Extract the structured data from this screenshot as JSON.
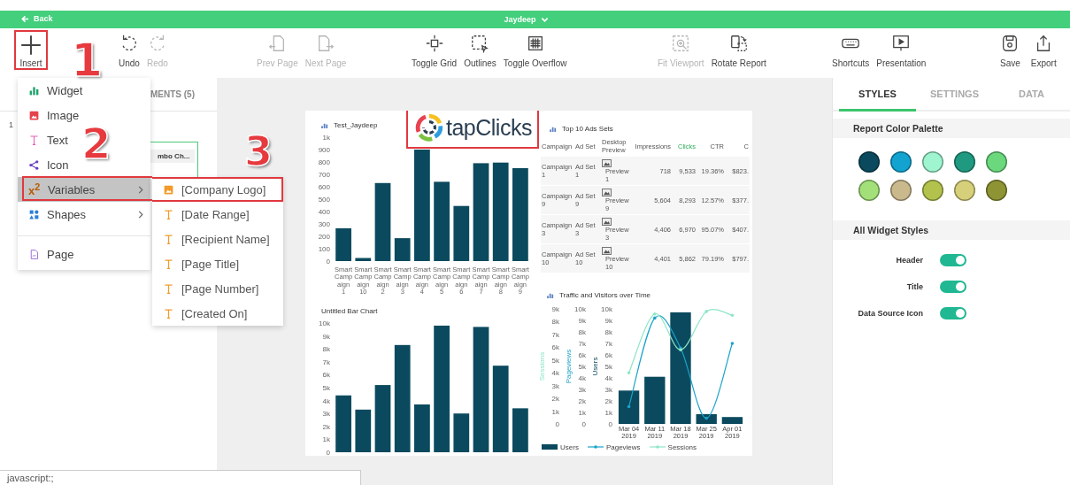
{
  "top_bar": {
    "back": "Back",
    "user": "Jaydeep"
  },
  "toolbar": {
    "groups": [
      [
        {
          "label": "Insert",
          "disabled": false,
          "highlighted": true
        }
      ],
      [
        {
          "label": "Undo",
          "disabled": false,
          "highlighted": false
        },
        {
          "label": "Redo",
          "disabled": true,
          "highlighted": false
        }
      ],
      [
        {
          "label": "Prev Page",
          "disabled": true,
          "highlighted": false
        },
        {
          "label": "Next Page",
          "disabled": true,
          "highlighted": false
        }
      ],
      [
        {
          "label": "Toggle Grid",
          "disabled": false,
          "highlighted": false
        },
        {
          "label": "Outlines",
          "disabled": false,
          "highlighted": false
        },
        {
          "label": "Toggle Overflow",
          "disabled": false,
          "highlighted": false
        }
      ],
      [
        {
          "label": "Fit Viewport",
          "disabled": true,
          "highlighted": false
        },
        {
          "label": "Rotate Report",
          "disabled": false,
          "highlighted": false
        }
      ],
      [
        {
          "label": "Shortcuts",
          "disabled": false,
          "highlighted": false
        },
        {
          "label": "Presentation",
          "disabled": false,
          "highlighted": false
        }
      ],
      [
        {
          "label": "Save",
          "disabled": false,
          "highlighted": false
        },
        {
          "label": "Export",
          "disabled": false,
          "highlighted": false
        }
      ]
    ]
  },
  "left_panel": {
    "tab": "MENTS (5)",
    "page_number": "1",
    "element": "mbo Ch..."
  },
  "insert_menu": {
    "items": [
      {
        "label": "Widget",
        "submenu": false,
        "hovered": false,
        "separator_before": false
      },
      {
        "label": "Image",
        "submenu": false,
        "hovered": false,
        "separator_before": false
      },
      {
        "label": "Text",
        "submenu": false,
        "hovered": false,
        "separator_before": false
      },
      {
        "label": "Icon",
        "submenu": false,
        "hovered": false,
        "separator_before": false
      },
      {
        "label": "Variables",
        "glyph": "x$^{2}$",
        "submenu": true,
        "hovered": true,
        "separator_before": false
      },
      {
        "label": "Shapes",
        "submenu": true,
        "hovered": false,
        "separator_before": false
      },
      {
        "label": "Page",
        "submenu": false,
        "hovered": false,
        "separator_before": true
      }
    ],
    "submenu": [
      {
        "label": "[Company Logo]",
        "kind": "image",
        "highlighted": true
      },
      {
        "label": "[Date Range]",
        "kind": "text",
        "highlighted": false
      },
      {
        "label": "[Recipient Name]",
        "kind": "text",
        "highlighted": false
      },
      {
        "label": "[Page Title]",
        "kind": "text",
        "highlighted": false
      },
      {
        "label": "[Page Number]",
        "kind": "text",
        "highlighted": false
      },
      {
        "label": "[Created On]",
        "kind": "text",
        "highlighted": false
      }
    ]
  },
  "callouts": [
    {
      "number": "1"
    },
    {
      "number": "2"
    },
    {
      "number": "3"
    }
  ],
  "report": {
    "bar_chart": {
      "title": "Test_Jaydeep",
      "chart_data": {
        "type": "bar",
        "categories": [
          "Smart Campaign 1",
          "Smart Campaign 10",
          "Smart Campaign 2",
          "Smart Campaign 3",
          "Smart Campaign 4",
          "Smart Campaign 5",
          "Smart Campaign 6",
          "Smart Campaign 7",
          "Smart Campaign 8",
          "Smart Campaign 9"
        ],
        "values": [
          265,
          25,
          630,
          185,
          900,
          640,
          445,
          790,
          795,
          750
        ],
        "ylim": [
          0,
          1000
        ],
        "yticks": [
          0,
          100,
          200,
          300,
          400,
          500,
          600,
          700,
          800,
          900,
          {
            "value": 1000,
            "label": "1k"
          }
        ]
      }
    },
    "logo": {
      "text": "tapClicks",
      "highlighted": true
    },
    "table": {
      "title": "Top 10 Ads Sets",
      "columns": [
        {
          "label": "Campaign",
          "sorted": false
        },
        {
          "label": "Ad Set",
          "sorted": false
        },
        {
          "label": "Desktop Preview",
          "sorted": false
        },
        {
          "label": "Impressions",
          "sorted": false
        },
        {
          "label": "Clicks",
          "sorted": true
        },
        {
          "label": "CTR",
          "sorted": false
        },
        {
          "label": "C",
          "sorted": false
        }
      ],
      "rows": [
        [
          "Campaign 1",
          "Ad Set 1",
          "Preview 1",
          "718",
          "9,533",
          "19.36%",
          "$823."
        ],
        [
          "Campaign 9",
          "Ad Set 9",
          "Preview 9",
          "5,604",
          "8,293",
          "12.57%",
          "$377."
        ],
        [
          "Campaign 3",
          "Ad Set 3",
          "Preview 3",
          "4,406",
          "6,970",
          "95.07%",
          "$407."
        ],
        [
          "Campaign 10",
          "Ad Set 10",
          "Preview 10",
          "4,401",
          "5,862",
          "79.19%",
          "$797."
        ]
      ]
    },
    "bar_chart_2": {
      "title": "Untitled Bar Chart",
      "chart_data": {
        "type": "bar",
        "values": [
          4400,
          3300,
          5200,
          8300,
          3700,
          9800,
          3000,
          9700,
          6700,
          3400
        ],
        "ylim": [
          0,
          10000
        ],
        "yticks": [
          0,
          {
            "value": 1000,
            "label": "1k"
          },
          {
            "value": 2000,
            "label": "2k"
          },
          {
            "value": 3000,
            "label": "3k"
          },
          {
            "value": 4000,
            "label": "4k"
          },
          {
            "value": 5000,
            "label": "5k"
          },
          {
            "value": 6000,
            "label": "6k"
          },
          {
            "value": 7000,
            "label": "7k"
          },
          {
            "value": 8000,
            "label": "8k"
          },
          {
            "value": 9000,
            "label": "9k"
          },
          {
            "value": 10000,
            "label": "10k"
          }
        ]
      }
    },
    "combo_chart": {
      "title": "Traffic and Visitors over Time",
      "chart_data": {
        "type": "bar",
        "categories": [
          "Mar 04 2019",
          "Mar 11 2019",
          "Mar 18 2019",
          "Mar 25 2019",
          "Apr 01 2019"
        ],
        "ylabel": "Pageviews",
        "ylim": [
          0,
          10000
        ],
        "yticks": [
          0,
          {
            "value": 1000,
            "label": "1k"
          },
          {
            "value": 2000,
            "label": "2k"
          },
          {
            "value": 3000,
            "label": "3k"
          },
          {
            "value": 4000,
            "label": "4k"
          },
          {
            "value": 5000,
            "label": "5k"
          },
          {
            "value": 6000,
            "label": "6k"
          },
          {
            "value": 7000,
            "label": "7k"
          },
          {
            "value": 8000,
            "label": "8k"
          },
          {
            "value": 9000,
            "label": "9k"
          },
          {
            "value": 10000,
            "label": "10k"
          }
        ],
        "y2label": "Users",
        "y2lim": [
          0,
          10000
        ],
        "y2ticks": [
          0,
          {
            "value": 1000,
            "label": "1k"
          },
          {
            "value": 2000,
            "label": "2k"
          },
          {
            "value": 3000,
            "label": "3k"
          },
          {
            "value": 4000,
            "label": "4k"
          },
          {
            "value": 5000,
            "label": "5k"
          },
          {
            "value": 6000,
            "label": "6k"
          },
          {
            "value": 7000,
            "label": "7k"
          },
          {
            "value": 8000,
            "label": "8k"
          },
          {
            "value": 9000,
            "label": "9k"
          },
          {
            "value": 10000,
            "label": "10k"
          }
        ],
        "y3label": "Sessions",
        "y3lim": [
          0,
          9000
        ],
        "y3ticks": [
          0,
          {
            "value": 1000,
            "label": "1k"
          },
          {
            "value": 2000,
            "label": "2k"
          },
          {
            "value": 3000,
            "label": "3k"
          },
          {
            "value": 4000,
            "label": "4k"
          },
          {
            "value": 5000,
            "label": "5k"
          },
          {
            "value": 6000,
            "label": "6k"
          },
          {
            "value": 7000,
            "label": "7k"
          },
          {
            "value": 8000,
            "label": "8k"
          },
          {
            "value": 9000,
            "label": "9k"
          }
        ],
        "legend": "bottom",
        "series": [
          {
            "name": "Users",
            "type": "bar",
            "axis": "y2",
            "color": "#0b4a5e",
            "values": [
              2900,
              4100,
              9700,
              850,
              600
            ]
          },
          {
            "name": "Pageviews",
            "type": "line",
            "color": "#1aa3c9",
            "values": [
              1500,
              9200,
              6600,
              500,
              7000
            ]
          },
          {
            "name": "Sessions",
            "type": "line",
            "axis": "y3",
            "color": "#8ee6c6",
            "values": [
              4000,
              8600,
              5800,
              8800,
              8500
            ]
          }
        ]
      }
    }
  },
  "right_panel": {
    "tabs": [
      {
        "label": "STYLES",
        "selected": true
      },
      {
        "label": "SETTINGS",
        "selected": false
      },
      {
        "label": "DATA",
        "selected": false
      }
    ],
    "palette_title": "Report Color Palette",
    "palette": [
      {
        "color": "#0b4a5e"
      },
      {
        "color": "#12a3d0"
      },
      {
        "color": "#9ef5cf"
      },
      {
        "color": "#1f9a80"
      },
      {
        "color": "#6bd87e"
      },
      {
        "color": "#a3e07a"
      },
      {
        "color": "#c9b98d"
      },
      {
        "color": "#b3c24d"
      },
      {
        "color": "#d7d07a"
      },
      {
        "color": "#8e9433"
      }
    ],
    "styles_title": "All Widget Styles",
    "toggles": [
      {
        "label": "Header",
        "on": true
      },
      {
        "label": "Title",
        "on": true
      },
      {
        "label": "Data Source Icon",
        "on": true
      }
    ]
  },
  "status_bar": "javascript:;"
}
